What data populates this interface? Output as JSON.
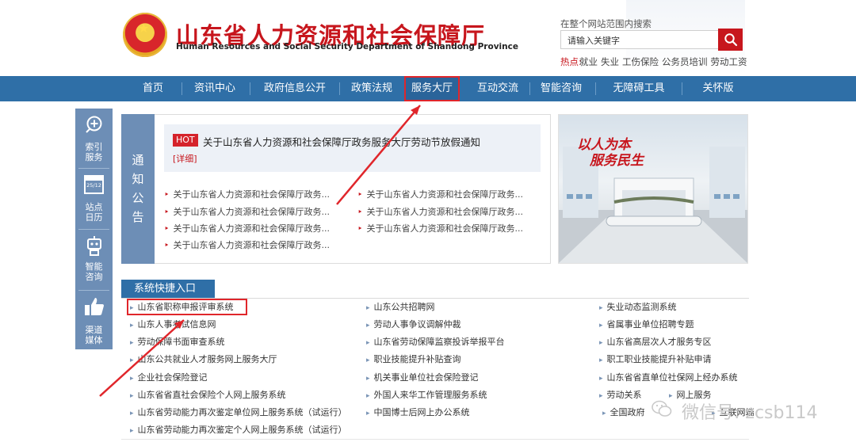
{
  "header": {
    "title": "山东省人力资源和社会保障厅",
    "subtitle": "Human Resources and Social Security Department of Shandong Province",
    "search_label": "在整个网站范围内搜索",
    "search_placeholder": "请输入关键字",
    "hot_label": "热点:",
    "hot_items": [
      "就业",
      "失业",
      "工伤保险",
      "公务员培训",
      "劳动工资"
    ]
  },
  "nav": {
    "items": [
      "首页",
      "资讯中心",
      "政府信息公开",
      "政策法规",
      "服务大厅",
      "互动交流",
      "智能咨询",
      "无障碍工具",
      "关怀版"
    ],
    "active": "服务大厅"
  },
  "side": {
    "items": [
      {
        "line1": "索引",
        "line2": "服务",
        "icon": "search-plus-icon"
      },
      {
        "line1": "站点",
        "line2": "日历",
        "icon": "calendar-icon",
        "badge": "25/12"
      },
      {
        "line1": "智能",
        "line2": "咨询",
        "icon": "robot-icon"
      },
      {
        "line1": "渠道",
        "line2": "媒体",
        "icon": "thumbs-up-icon"
      }
    ]
  },
  "notice": {
    "side_label": [
      "通",
      "知",
      "公",
      "告"
    ],
    "hot_badge": "HOT",
    "hot_title": "关于山东省人力资源和社会保障厅政务服务大厅劳动节放假通知",
    "hot_detail": "[详细]",
    "items": [
      "关于山东省人力资源和社会保障厅政务...",
      "关于山东省人力资源和社会保障厅政务...",
      "关于山东省人力资源和社会保障厅政务...",
      "关于山东省人力资源和社会保障厅政务...",
      "关于山东省人力资源和社会保障厅政务...",
      "关于山东省人力资源和社会保障厅政务...",
      "关于山东省人力资源和社会保障厅政务..."
    ]
  },
  "banner": {
    "line1": "以人为本",
    "line2": "服务民生"
  },
  "quick": {
    "tab": "系统快捷入口",
    "col1": [
      "山东省职称申报评审系统",
      "山东人事考试信息网",
      "劳动保障书面审查系统",
      "山东公共就业人才服务网上服务大厅",
      "企业社会保险登记",
      "山东省省直社会保险个人网上服务系统",
      "山东省劳动能力再次鉴定单位网上服务系统（试运行）",
      "山东省劳动能力再次鉴定个人网上服务系统（试运行）"
    ],
    "col2": [
      "山东公共招聘网",
      "劳动人事争议调解仲裁",
      "山东省劳动保障监察投诉举报平台",
      "职业技能提升补贴查询",
      "机关事业单位社会保险登记",
      "外国人来华工作管理服务系统",
      "中国博士后网上办公系统"
    ],
    "col3": [
      "失业动态监测系统",
      "省属事业单位招聘专题",
      "山东省高层次人才服务专区",
      "职工职业技能提升补贴申请",
      "山东省省直单位社保网上经办系统",
      "劳动关系",
      "全国政府"
    ],
    "col3_extra": [
      "网上服务",
      "互联网端"
    ]
  },
  "watermark": "微信号: zcsb114",
  "colors": {
    "brand_red": "#c7161d",
    "nav_blue": "#2f6fa7",
    "side_blue": "#6d8eb6",
    "annotation_red": "#e0262b"
  }
}
